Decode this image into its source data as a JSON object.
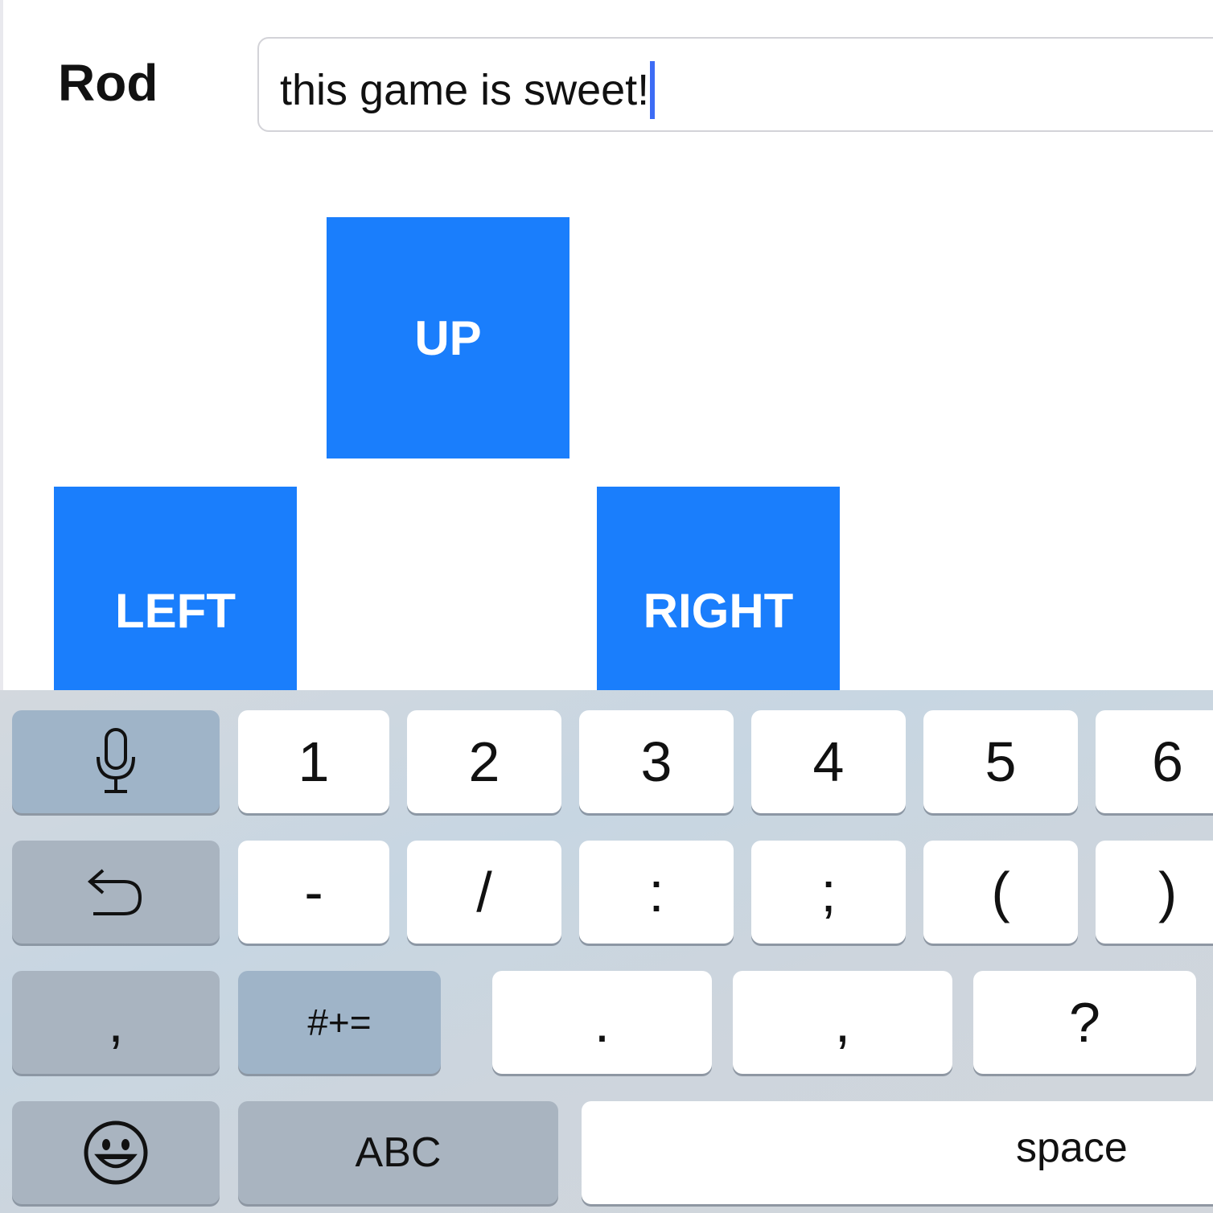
{
  "header": {
    "name_label": "Rod",
    "message_value": "this game is sweet!"
  },
  "controls": {
    "up_label": "UP",
    "left_label": "LEFT",
    "right_label": "RIGHT",
    "button_color": "#1a7efc"
  },
  "keyboard": {
    "row1": [
      "1",
      "2",
      "3",
      "4",
      "5",
      "6"
    ],
    "row2": [
      "-",
      "/",
      ":",
      ";",
      "(",
      ")"
    ],
    "row3": {
      "left_key": ",",
      "symbols_key": "#+=",
      "keys": [
        ".",
        ",",
        "?"
      ]
    },
    "row4": {
      "abc_key": "ABC",
      "space_key": "space"
    },
    "icons": {
      "mic": "microphone-icon",
      "undo": "undo-icon",
      "emoji": "emoji-icon"
    }
  }
}
